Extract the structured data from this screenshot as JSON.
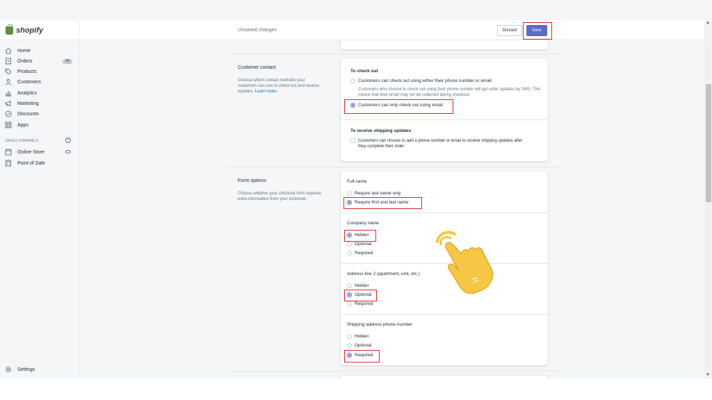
{
  "app": {
    "logo_text": "shopify",
    "brand_color": "#5e8e3e",
    "accent_color": "#5c6ac4"
  },
  "topbar": {
    "status": "Unsaved changes",
    "discard_label": "Discard",
    "save_label": "Save"
  },
  "sidebar": {
    "items": [
      {
        "label": "Home",
        "icon": "home-icon"
      },
      {
        "label": "Orders",
        "icon": "orders-icon",
        "badge": "15"
      },
      {
        "label": "Products",
        "icon": "tag-icon"
      },
      {
        "label": "Customers",
        "icon": "person-icon"
      },
      {
        "label": "Analytics",
        "icon": "bar-chart-icon"
      },
      {
        "label": "Marketing",
        "icon": "megaphone-icon"
      },
      {
        "label": "Discounts",
        "icon": "discount-icon"
      },
      {
        "label": "Apps",
        "icon": "apps-icon"
      }
    ],
    "channels_label": "SALES CHANNELS",
    "channels": [
      {
        "label": "Online Store",
        "icon": "store-icon"
      },
      {
        "label": "Point of Sale",
        "icon": "pos-icon"
      }
    ],
    "settings_label": "Settings"
  },
  "customer_contact": {
    "title": "Customer contact",
    "description": "Choose which contact methods your customers can use to check out and receive updates.",
    "learn_more": "Learn more.",
    "checkout_heading": "To check out",
    "option_phone_or_email": "Customers can check out using either their phone number or email",
    "option_phone_help": "Customers who choose to check out using their phone number will get order updates by SMS. This means that their email may not be collected during checkout.",
    "option_email_only": "Customers can only check out using email",
    "shipping_updates_heading": "To receive shipping updates",
    "shipping_updates_option": "Customers can choose to add a phone number or email to receive shipping updates after they complete their order"
  },
  "form_options": {
    "title": "Form options",
    "description": "Choose whether your checkout form requires extra information from your customer.",
    "full_name": {
      "label": "Full name",
      "options": [
        "Require last name only",
        "Require first and last name"
      ],
      "selected": "Require first and last name"
    },
    "company_name": {
      "label": "Company name",
      "options": [
        "Hidden",
        "Optional",
        "Required"
      ],
      "selected": "Hidden"
    },
    "address_line_2": {
      "label": "Address line 2 (apartment, unit, etc.)",
      "options": [
        "Hidden",
        "Optional",
        "Required"
      ],
      "selected": "Optional"
    },
    "shipping_phone": {
      "label": "Shipping address phone number",
      "options": [
        "Hidden",
        "Optional",
        "Required"
      ],
      "selected": "Required"
    }
  }
}
